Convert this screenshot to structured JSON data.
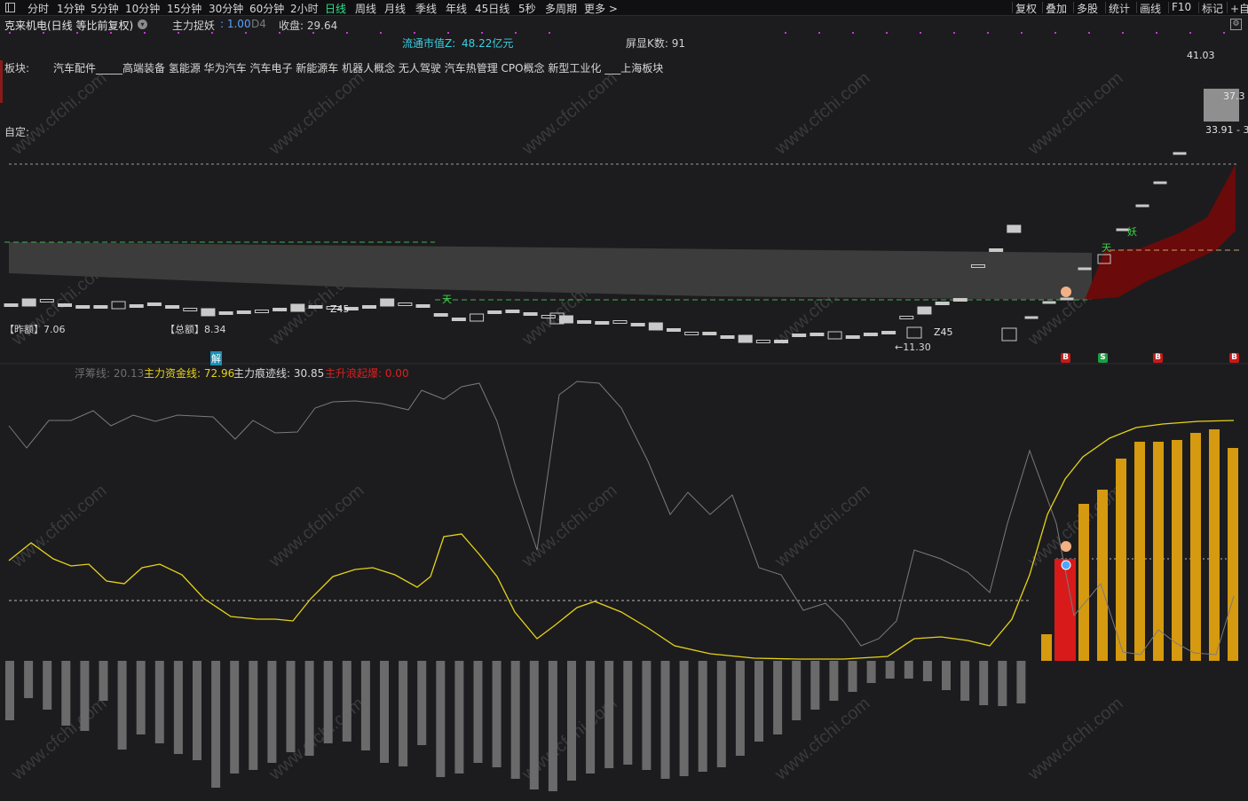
{
  "topbar": {
    "periods": [
      "分时",
      "1分钟",
      "5分钟",
      "10分钟",
      "15分钟",
      "30分钟",
      "60分钟",
      "2小时",
      "日线",
      "周线",
      "月线",
      "季线",
      "年线",
      "45日线",
      "5秒",
      "多周期",
      "更多 >"
    ],
    "active_period": "日线",
    "tools": [
      "复权",
      "叠加",
      "多股",
      "统计",
      "画线",
      "F10",
      "标记",
      "+自"
    ]
  },
  "header": {
    "stock_name": "克来机电(日线 等比前复权)",
    "indicator_name": "主力捉妖",
    "indicator_value": ": 1.00",
    "indicator_d4": "D4",
    "close_label": "收盘: 29.64",
    "market_cap_label": "流通市值Z:",
    "market_cap_value": "48.22亿元",
    "visible_k_label": "屏显K数: 91",
    "sector_label": "板块:",
    "sector_list": "汽车配件_____高端装备 氢能源 华为汽车 汽车电子 新能源车 机器人概念 无人驾驶 汽车热管理 CPO概念 新型工业化 ___上海板块",
    "custom_label": "自定:"
  },
  "price_panel": {
    "price_high_label": "41.03",
    "price_mid_label": "37.3",
    "price_low_label": "33.91 - 3",
    "z45_a": "Z45",
    "z45_b": "Z45",
    "low_mark": "←11.30",
    "tian_a": "天",
    "tian_b": "天",
    "yao_mark": "妖",
    "yesterday_amount": "【昨额】7.06",
    "total_amount": "【总额】8.34",
    "jie_mark": "解",
    "tags": [
      "B",
      "S",
      "B",
      "B"
    ],
    "colors": {
      "band_gray": "#3c3c3c",
      "band_red": "#6a0a0a",
      "green_dash": "#3fb04a",
      "candle": "#c9c9c9"
    }
  },
  "indicator_panel": {
    "fuchou_label": "浮筹线: 20.13",
    "main_money_label": "主力资金线: 72.96",
    "main_trace_label": "主力痕迹线: 30.85",
    "main_rise_label": "主升浪起爆: 0.00",
    "colors": {
      "fuchou": "#6e6e6e",
      "main_money": "#e6d21a",
      "main_trace": "#d8d8d8",
      "main_rise": "#e01e1e",
      "bar_gold": "#d59a0f",
      "bar_gray": "#6a6a6a"
    }
  },
  "watermark": "www.cfchi.com"
}
